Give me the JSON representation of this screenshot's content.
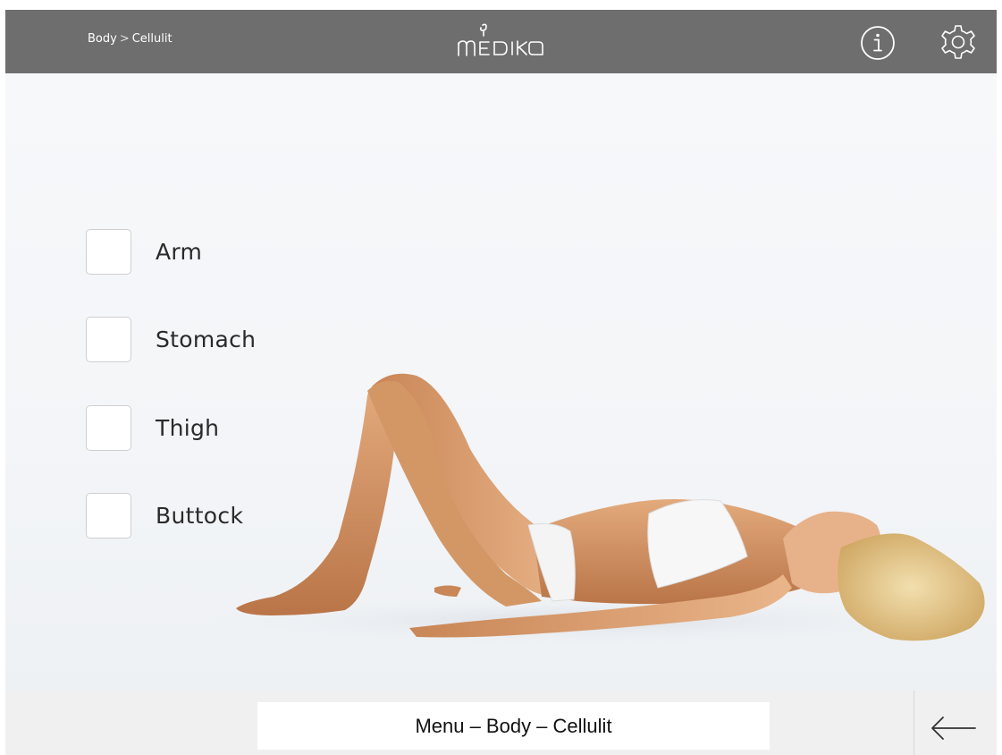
{
  "header": {
    "breadcrumb": {
      "parent": "Body",
      "separator": ">",
      "current": "Cellulit"
    },
    "logo_text": "medika",
    "info_icon": "info-icon",
    "settings_icon": "gear-icon"
  },
  "options": [
    {
      "label": "Arm",
      "checked": false
    },
    {
      "label": "Stomach",
      "checked": false
    },
    {
      "label": "Thigh",
      "checked": false
    },
    {
      "label": "Buttock",
      "checked": false
    }
  ],
  "footer": {
    "caption": "Menu – Body – Cellulit",
    "back_icon": "arrow-left-icon"
  },
  "colors": {
    "header_bg": "#6e6e6e",
    "footer_bg": "#f0f0f0",
    "text": "#2a2a2a"
  }
}
